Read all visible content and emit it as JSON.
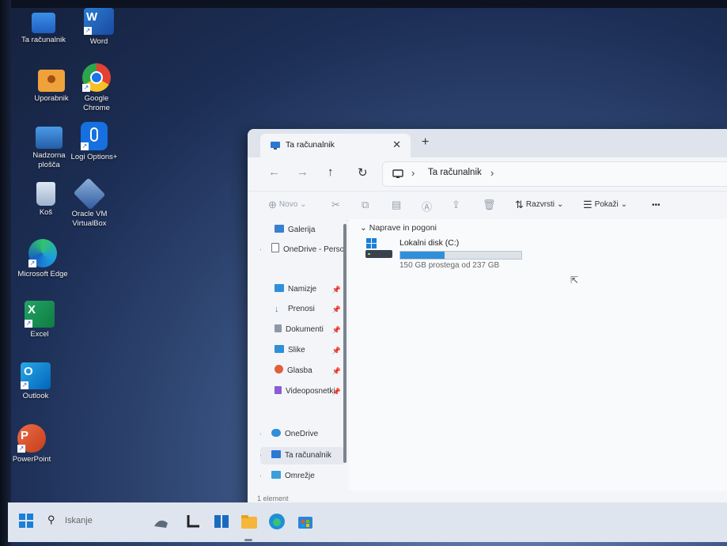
{
  "desktop": {
    "icons": [
      {
        "label": "Ta računalnik",
        "icon": "computer-icon"
      },
      {
        "label": "Word",
        "icon": "word-icon"
      },
      {
        "label": "Uporabnik",
        "icon": "user-folder-icon"
      },
      {
        "label": "Google Chrome",
        "icon": "chrome-icon"
      },
      {
        "label": "Nadzorna plošča",
        "icon": "control-panel-icon"
      },
      {
        "label": "Logi Options+",
        "icon": "logi-options-icon"
      },
      {
        "label": "Koš",
        "icon": "recycle-bin-icon"
      },
      {
        "label": "Oracle VM VirtualBox",
        "icon": "virtualbox-icon"
      },
      {
        "label": "Microsoft Edge",
        "icon": "edge-icon"
      },
      {
        "label": "Excel",
        "icon": "excel-icon"
      },
      {
        "label": "Outlook",
        "icon": "outlook-icon"
      },
      {
        "label": "PowerPoint",
        "icon": "powerpoint-icon"
      }
    ]
  },
  "explorer": {
    "tab_title": "Ta računalnik",
    "close_glyph": "✕",
    "newtab_glyph": "+",
    "address": {
      "crumb": "Ta računalnik"
    },
    "toolbar": {
      "new_label": "Novo",
      "sort_label": "Razvrsti",
      "view_label": "Pokaži",
      "more_glyph": "•••"
    },
    "nav": {
      "items": [
        {
          "label": "Galerija"
        },
        {
          "label": "OneDrive - Perso"
        },
        {
          "label": "Namizje"
        },
        {
          "label": "Prenosi"
        },
        {
          "label": "Dokumenti"
        },
        {
          "label": "Slike"
        },
        {
          "label": "Glasba"
        },
        {
          "label": "Videoposnetki"
        },
        {
          "label": "OneDrive"
        },
        {
          "label": "Ta računalnik"
        },
        {
          "label": "Omrežje"
        }
      ]
    },
    "content": {
      "group_header": "Naprave in pogoni",
      "drive": {
        "label": "Lokalni disk (C:)",
        "free_text": "150 GB prostega od 237 GB",
        "used_fraction": 0.367
      }
    },
    "status": "1 element"
  },
  "taskbar": {
    "search_placeholder": "Iskanje",
    "colors": {
      "start": "#1a7fd8",
      "drive_fill": "#2f8fd9"
    }
  }
}
